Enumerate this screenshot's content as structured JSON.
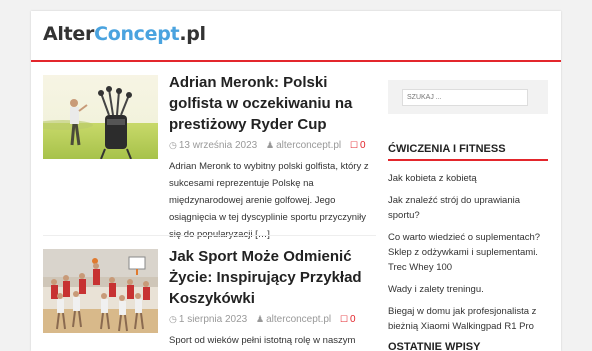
{
  "header": {
    "logo_part1": "Alter",
    "logo_part2": "Concept",
    "logo_part3": ".pl"
  },
  "posts": [
    {
      "title": "Adrian Meronk: Polski golfista w oczekiwaniu na prestiżowy Ryder Cup",
      "date": "13 września 2023",
      "author": "alterconcept.pl",
      "comments": "0",
      "excerpt": "Adrian Meronk to wybitny polski golfista, który z sukcesami reprezentuje Polskę na międzynarodowej arenie golfowej. Jego osiągnięcia w tej dyscyplinie sportu przyczyniły się do popularyzacji […]"
    },
    {
      "title": "Jak Sport Może Odmienić Życie: Inspirujący Przykład Koszykówki",
      "date": "1 sierpnia 2023",
      "author": "alterconcept.pl",
      "comments": "0",
      "excerpt": "Sport od wieków pełni istotną rolę w naszym"
    }
  ],
  "sidebar": {
    "search_placeholder": "SZUKAJ ...",
    "widget1_title": "ĆWICZENIA I FITNESS",
    "links": [
      "Jak kobieta z kobietą",
      "Jak znaleźć strój do uprawiania sportu?",
      "Co warto wiedzieć o suplementach? Sklep z odżywkami i suplementami. Trec Whey 100",
      "Wady i zalety treningu.",
      "Biegaj w domu jak profesjonalista z bieżnią Xiaomi Walkingpad R1 Pro"
    ],
    "widget2_title": "OSTATNIE WPISY"
  },
  "colors": {
    "accent": "#e3262c",
    "logo_blue": "#4aa3df"
  },
  "icons": {
    "clock": "clock-icon",
    "user": "user-icon",
    "comment": "comment-icon"
  }
}
